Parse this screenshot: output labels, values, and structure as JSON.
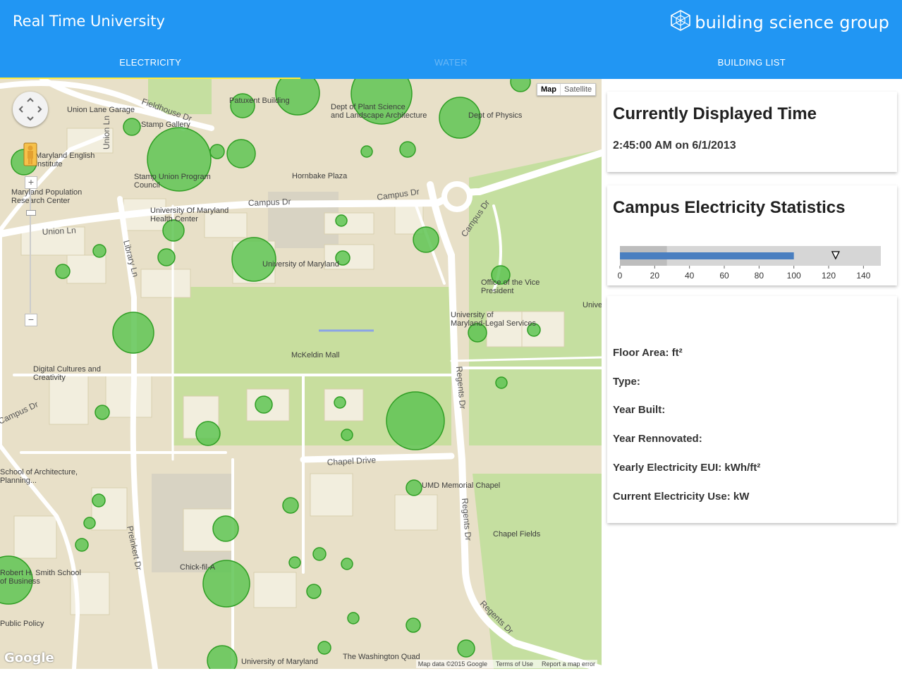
{
  "header": {
    "app_title": "Real Time University",
    "brand_name": "building science group",
    "brand_icon": "hexagon-network-icon"
  },
  "tabs": [
    {
      "label": "ELECTRICITY",
      "active": true
    },
    {
      "label": "WATER",
      "active": false
    },
    {
      "label": "BUILDING LIST",
      "active": false
    }
  ],
  "map": {
    "map_type_buttons": [
      "Map",
      "Satellite"
    ],
    "selected_map_type": "Map",
    "attribution": [
      "Map data ©2015 Google",
      "Terms of Use",
      "Report a map error"
    ],
    "logo_text": "Google",
    "roads": [
      "Fieldhouse Dr",
      "Campus Dr",
      "Campus Dr",
      "Campus Dr",
      "Union Ln",
      "Union Ln",
      "Library Ln",
      "Campus Dr",
      "Regents Dr",
      "Regents Dr",
      "Regents Dr",
      "Chapel Drive",
      "Preinkert Dr"
    ],
    "places": [
      "Union Lane Garage",
      "Patuxent Building",
      "Dept of Plant Science and Landscape Architecture",
      "Dept of Physics",
      "Stamp Gallery",
      "Maryland English Institute",
      "Stamp Union Program Council",
      "Hornbake Plaza",
      "Maryland Population Research Center",
      "University Of Maryland Health Center",
      "University of Maryland",
      "Office of the Vice President",
      "Unive",
      "University of Maryland-Legal Services",
      "McKeldin Mall",
      "Digital Cultures and Creativity",
      "School of Architecture, Planning...",
      "UMD Memorial Chapel",
      "Chapel Fields",
      "Robert H. Smith School of Business",
      "Chick-fil-A",
      "Public Policy",
      "University of Maryland",
      "The Washington Quad"
    ],
    "marker_count": 44,
    "colors": {
      "marker_fill": "#5fc454",
      "marker_stroke": "#2f9e24",
      "road": "#ffffff",
      "land": "#e8e0c8",
      "park": "#c5dfa0"
    }
  },
  "time_panel": {
    "title": "Currently Displayed Time",
    "value": "2:45:00 AM on 6/1/2013"
  },
  "stats_panel": {
    "title": "Campus Electricity Statistics",
    "bullet": {
      "ticks": [
        "0",
        "20",
        "40",
        "60",
        "80",
        "100",
        "120",
        "140"
      ],
      "range_max": 150,
      "range_dark_end": 27,
      "measure": 100,
      "marker": 124,
      "colors": {
        "range_light": "#d6d6d6",
        "range_dark": "#bdbdbd",
        "measure": "#4a7fc0"
      }
    }
  },
  "info_panel": {
    "rows": [
      "Floor Area: ft²",
      "Type:",
      "Year Built:",
      "Year Rennovated:",
      "Yearly Electricity EUI: kWh/ft²",
      "Current Electricity Use: kW"
    ]
  },
  "colors": {
    "header": "#2196f3",
    "tab_indicator": "#ffeb3b"
  }
}
